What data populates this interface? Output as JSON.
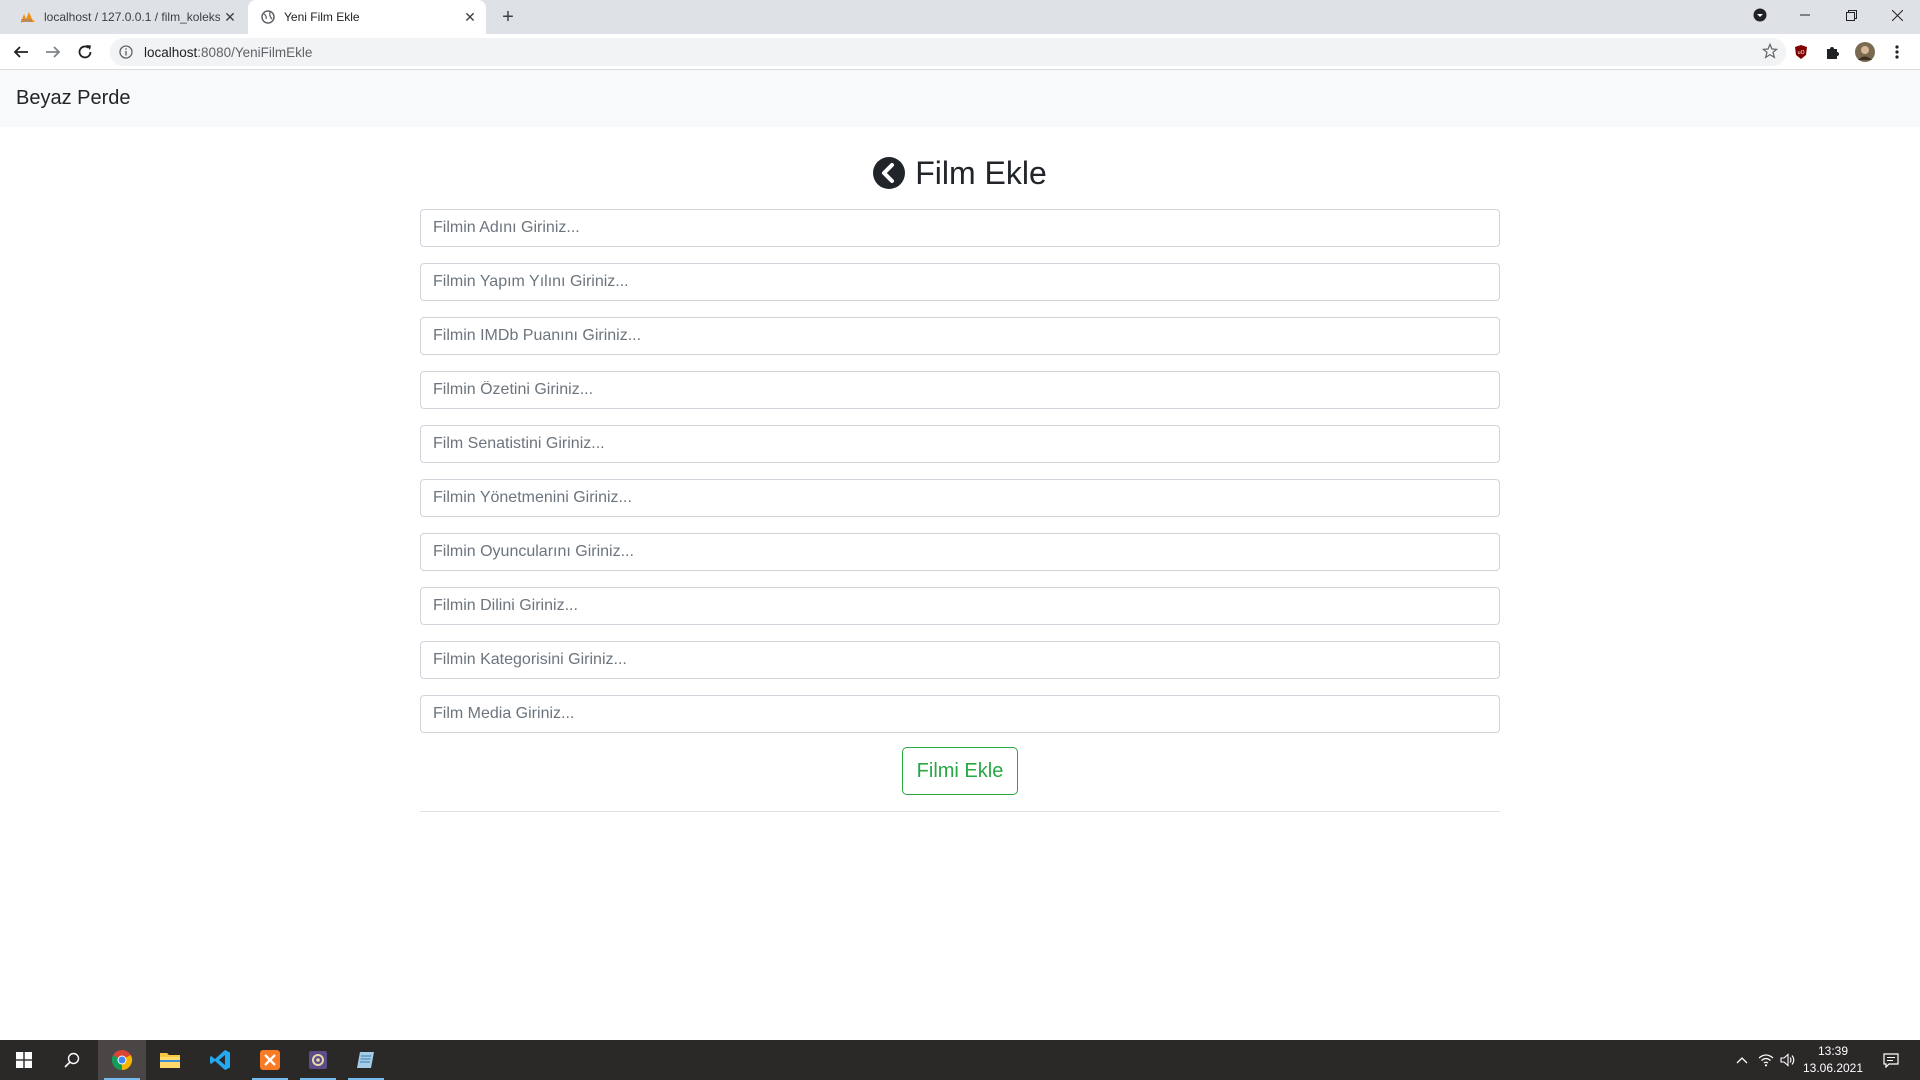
{
  "browser": {
    "tabs": [
      {
        "title": "localhost / 127.0.0.1 / film_koleks",
        "favicon": "phpmyadmin-icon",
        "active": false
      },
      {
        "title": "Yeni Film Ekle",
        "favicon": "globe-icon",
        "active": true
      }
    ],
    "url_host": "localhost",
    "url_path": ":8080/YeniFilmEkle"
  },
  "navbar": {
    "brand": "Beyaz Perde"
  },
  "main": {
    "title": "Film Ekle",
    "back_icon": "chevron-circle-left-icon",
    "fields": [
      {
        "placeholder": "Filmin Adını Giriniz...",
        "value": ""
      },
      {
        "placeholder": "Filmin Yapım Yılını Giriniz...",
        "value": ""
      },
      {
        "placeholder": "Filmin IMDb Puanını Giriniz...",
        "value": ""
      },
      {
        "placeholder": "Filmin Özetini Giriniz...",
        "value": ""
      },
      {
        "placeholder": "Film Senatistini Giriniz...",
        "value": ""
      },
      {
        "placeholder": "Filmin Yönetmenini Giriniz...",
        "value": ""
      },
      {
        "placeholder": "Filmin Oyuncularını Giriniz...",
        "value": ""
      },
      {
        "placeholder": "Filmin Dilini Giriniz...",
        "value": ""
      },
      {
        "placeholder": "Filmin Kategorisini Giriniz...",
        "value": ""
      },
      {
        "placeholder": "Film Media Giriniz...",
        "value": ""
      }
    ],
    "submit_label": "Filmi Ekle"
  },
  "taskbar": {
    "time": "13:39",
    "date": "13.06.2021",
    "apps": [
      "start-icon",
      "search-icon",
      "chrome-icon",
      "file-explorer-icon",
      "vscode-icon",
      "xampp-icon",
      "app-icon",
      "notepad-icon"
    ]
  },
  "colors": {
    "accent_green": "#28a745",
    "navbar_bg": "#f8f9fa",
    "taskbar_bg": "#2b2828"
  }
}
